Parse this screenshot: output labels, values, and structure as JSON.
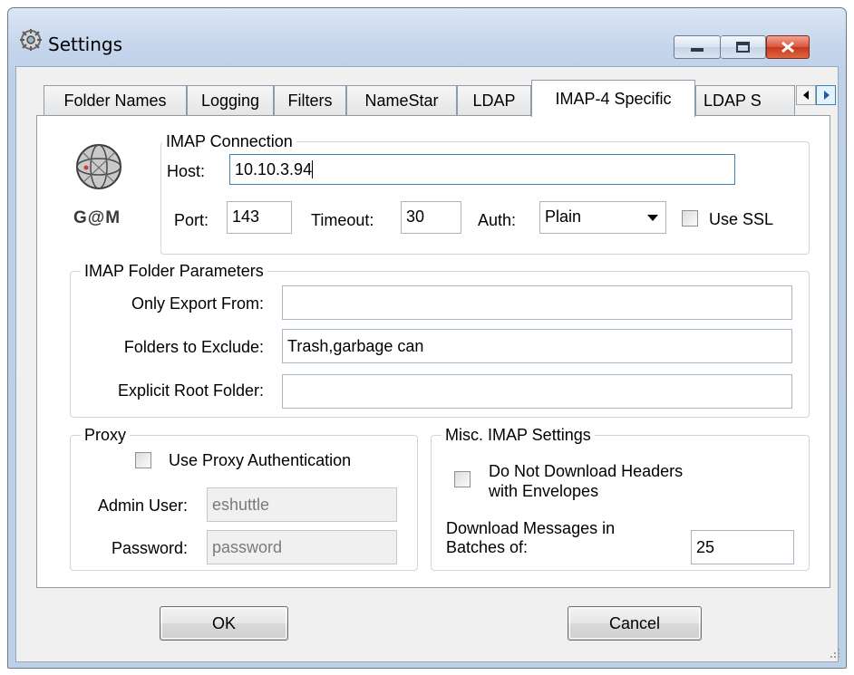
{
  "window": {
    "title": "Settings"
  },
  "tabs": [
    {
      "label": "Folder Names"
    },
    {
      "label": "Logging"
    },
    {
      "label": "Filters"
    },
    {
      "label": "NameStar"
    },
    {
      "label": "LDAP"
    },
    {
      "label": "IMAP-4 Specific",
      "active": true
    },
    {
      "label": "LDAP S"
    }
  ],
  "logo": {
    "text": "G@M"
  },
  "imap_connection": {
    "legend": "IMAP Connection",
    "host_label": "Host:",
    "host_value": "10.10.3.94",
    "port_label": "Port:",
    "port_value": "143",
    "timeout_label": "Timeout:",
    "timeout_value": "30",
    "auth_label": "Auth:",
    "auth_value": "Plain",
    "ssl_label": "Use SSL",
    "ssl_checked": false
  },
  "imap_folders": {
    "legend": "IMAP Folder Parameters",
    "export_from_label": "Only Export From:",
    "export_from_value": "",
    "exclude_label": "Folders to Exclude:",
    "exclude_value": "Trash,garbage can",
    "root_label": "Explicit Root Folder:",
    "root_value": ""
  },
  "proxy": {
    "legend": "Proxy",
    "auth_label": "Use Proxy Authentication",
    "auth_checked": false,
    "admin_label": "Admin User:",
    "admin_value": "eshuttle",
    "password_label": "Password:",
    "password_value": "password"
  },
  "misc": {
    "legend": "Misc. IMAP Settings",
    "headers_label_line1": "Do Not Download Headers",
    "headers_label_line2": "with Envelopes",
    "headers_checked": false,
    "batch_label_line1": "Download Messages in",
    "batch_label_line2": "Batches of:",
    "batch_value": "25"
  },
  "buttons": {
    "ok": "OK",
    "cancel": "Cancel"
  },
  "colors": {
    "title_bar": "#c4d5ec",
    "close_button": "#c7381f",
    "panel_bg": "#f0f0f0"
  }
}
